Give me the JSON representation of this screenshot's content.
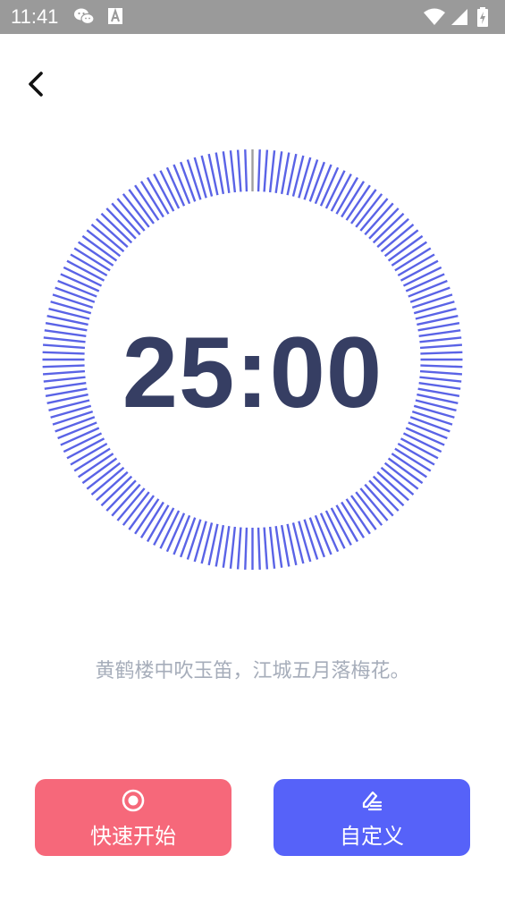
{
  "status_bar": {
    "time": "11:41",
    "left_icons": [
      "wechat-icon",
      "a-notification-icon"
    ],
    "right_icons": [
      "wifi-icon",
      "cell-signal-icon",
      "battery-icon"
    ],
    "background": "#9a9a9a"
  },
  "nav": {
    "back_icon": "chevron-left-icon"
  },
  "timer": {
    "display": "25:00",
    "dial_active_color": "#5a63e6",
    "dial_marker_color": "#9e9e9e",
    "text_color": "#363e63"
  },
  "quote": "黄鹤楼中吹玉笛，江城五月落梅花。",
  "buttons": {
    "quick_start": {
      "label": "快速开始",
      "icon": "record-icon",
      "color": "#f6687a"
    },
    "custom": {
      "label": "自定义",
      "icon": "edit-icon",
      "color": "#5662f9"
    }
  }
}
